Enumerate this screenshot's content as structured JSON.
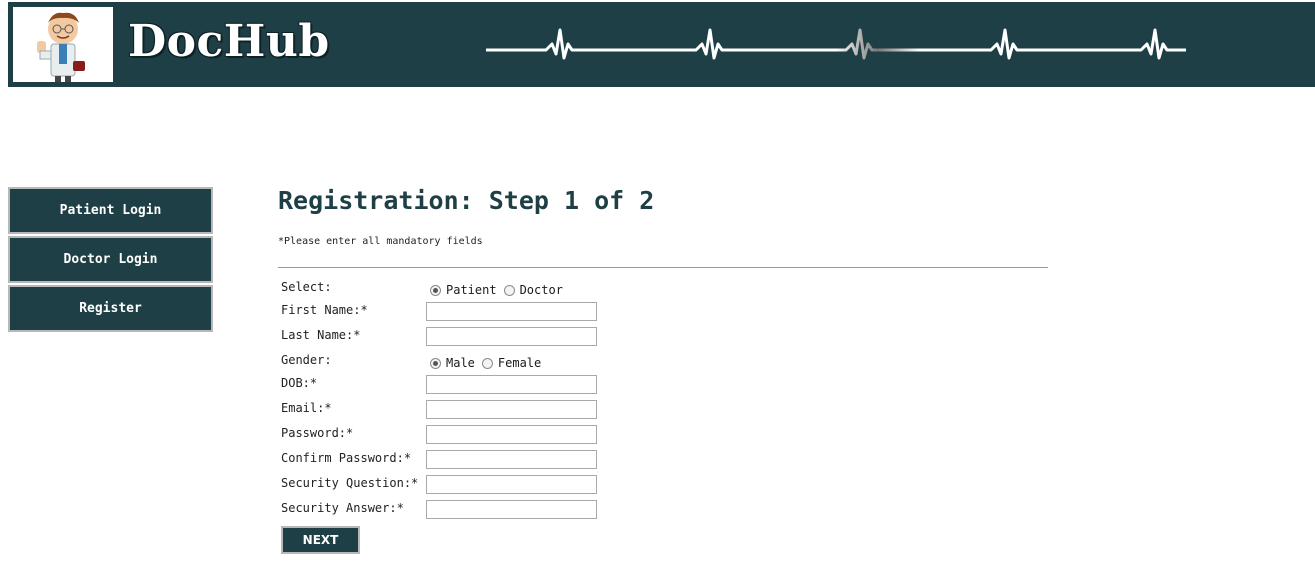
{
  "header": {
    "brand": "DocHub"
  },
  "nav": {
    "items": [
      {
        "label": "Patient Login"
      },
      {
        "label": "Doctor Login"
      },
      {
        "label": "Register"
      }
    ]
  },
  "main": {
    "title": "Registration: Step 1 of 2",
    "note": "*Please enter all mandatory fields",
    "select": {
      "label": "Select:",
      "options": [
        "Patient",
        "Doctor"
      ],
      "selected": "Patient"
    },
    "first_name": {
      "label": "First Name:*",
      "value": ""
    },
    "last_name": {
      "label": "Last Name:*",
      "value": ""
    },
    "gender": {
      "label": "Gender:",
      "options": [
        "Male",
        "Female"
      ],
      "selected": "Male"
    },
    "dob": {
      "label": "DOB:*",
      "value": ""
    },
    "email": {
      "label": "Email:*",
      "value": ""
    },
    "password": {
      "label": "Password:*",
      "value": ""
    },
    "confirm_password": {
      "label": "Confirm Password:*",
      "value": ""
    },
    "security_question": {
      "label": "Security Question:*",
      "value": ""
    },
    "security_answer": {
      "label": "Security Answer:*",
      "value": ""
    },
    "next_label": "NEXT"
  },
  "colors": {
    "primary": "#1e3f45",
    "border": "#b8b8b8"
  }
}
